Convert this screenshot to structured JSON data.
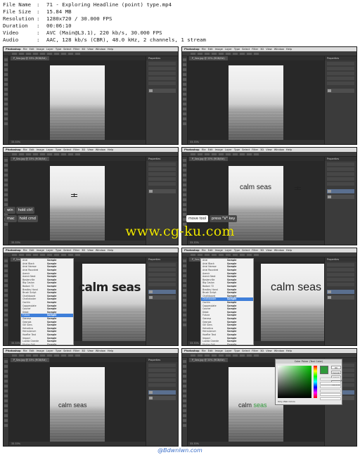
{
  "media_info": [
    {
      "key": "File Name",
      "value": "71 - Exploring Headline (point) type.mp4"
    },
    {
      "key": "File Size",
      "value": "15.84 MB"
    },
    {
      "key": "Resolution",
      "value": "1280x720 / 30.000 FPS"
    },
    {
      "key": "Duration",
      "value": "00:06:10"
    },
    {
      "key": "Video",
      "value": "AVC (Main@L3.1), 220 kb/s, 30.000 FPS"
    },
    {
      "key": "Audio",
      "value": "AAC, 128 kb/s (CBR), 48.0 kHz, 2 channels, 1 stream"
    }
  ],
  "separator": ":",
  "app": {
    "name": "Photoshop",
    "menu": [
      "File",
      "Edit",
      "Image",
      "Layer",
      "Type",
      "Select",
      "Filter",
      "3D",
      "View",
      "Window",
      "Help"
    ],
    "doc_tab": "P_Sea.jpg @ 33% (RGB/8#)",
    "panel_title": "Properties",
    "status": "33.33%",
    "brand": "Linked"
  },
  "frames": [
    {
      "id": 1,
      "headline": ""
    },
    {
      "id": 2,
      "headline": ""
    },
    {
      "id": 3,
      "headline": "",
      "key_hints": [
        {
          "platform": "win",
          "key": "hold ctrl"
        },
        {
          "platform": "mac",
          "key": "hold cmd"
        }
      ]
    },
    {
      "id": 4,
      "headline": "calm seas",
      "key_hints_right": [
        "move tool",
        "press \"V\" key"
      ]
    },
    {
      "id": 5,
      "headline": "calm seas",
      "font_menu": true
    },
    {
      "id": 6,
      "headline": "calm seas",
      "font_menu": true
    },
    {
      "id": 7,
      "headline": "calm seas"
    },
    {
      "id": 8,
      "headline_parts": [
        "calm",
        "seas"
      ],
      "color_picker": true
    }
  ],
  "font_list": [
    "Arial",
    "Arial Black",
    "Arial Narrow",
    "Arial Rounded",
    "Avenir",
    "Avenir Next",
    "Baskerville",
    "Big Caslon",
    "Bodoni 72",
    "Bradley Hand",
    "Brush Script",
    "Chalkboard",
    "Chalkduster",
    "Cochin",
    "Copperplate",
    "Courier",
    "Didot",
    "Futura",
    "Geneva",
    "Georgia",
    "Gill Sans",
    "Helvetica",
    "Herculanum",
    "Hoefler Text",
    "Impact",
    "Lucida Grande",
    "Marker Felt",
    "Menlo",
    "Monaco",
    "Optima",
    "Palatino",
    "Papyrus"
  ],
  "font_sample": "Sample",
  "picker": {
    "title": "Color Picker (Text Color)",
    "ok": "OK",
    "cancel": "Cancel",
    "add": "Add to Swatches",
    "libraries": "Color Libraries",
    "only_web": "Only Web Colors",
    "selected_color": "#2f9a3a"
  },
  "watermark": "www.cg-ku.com",
  "footer": "@Bdwnlwn.com",
  "colors": {
    "headline_text": "#222222",
    "green_accent": "#2f9a3a",
    "watermark": "#f0e800"
  }
}
